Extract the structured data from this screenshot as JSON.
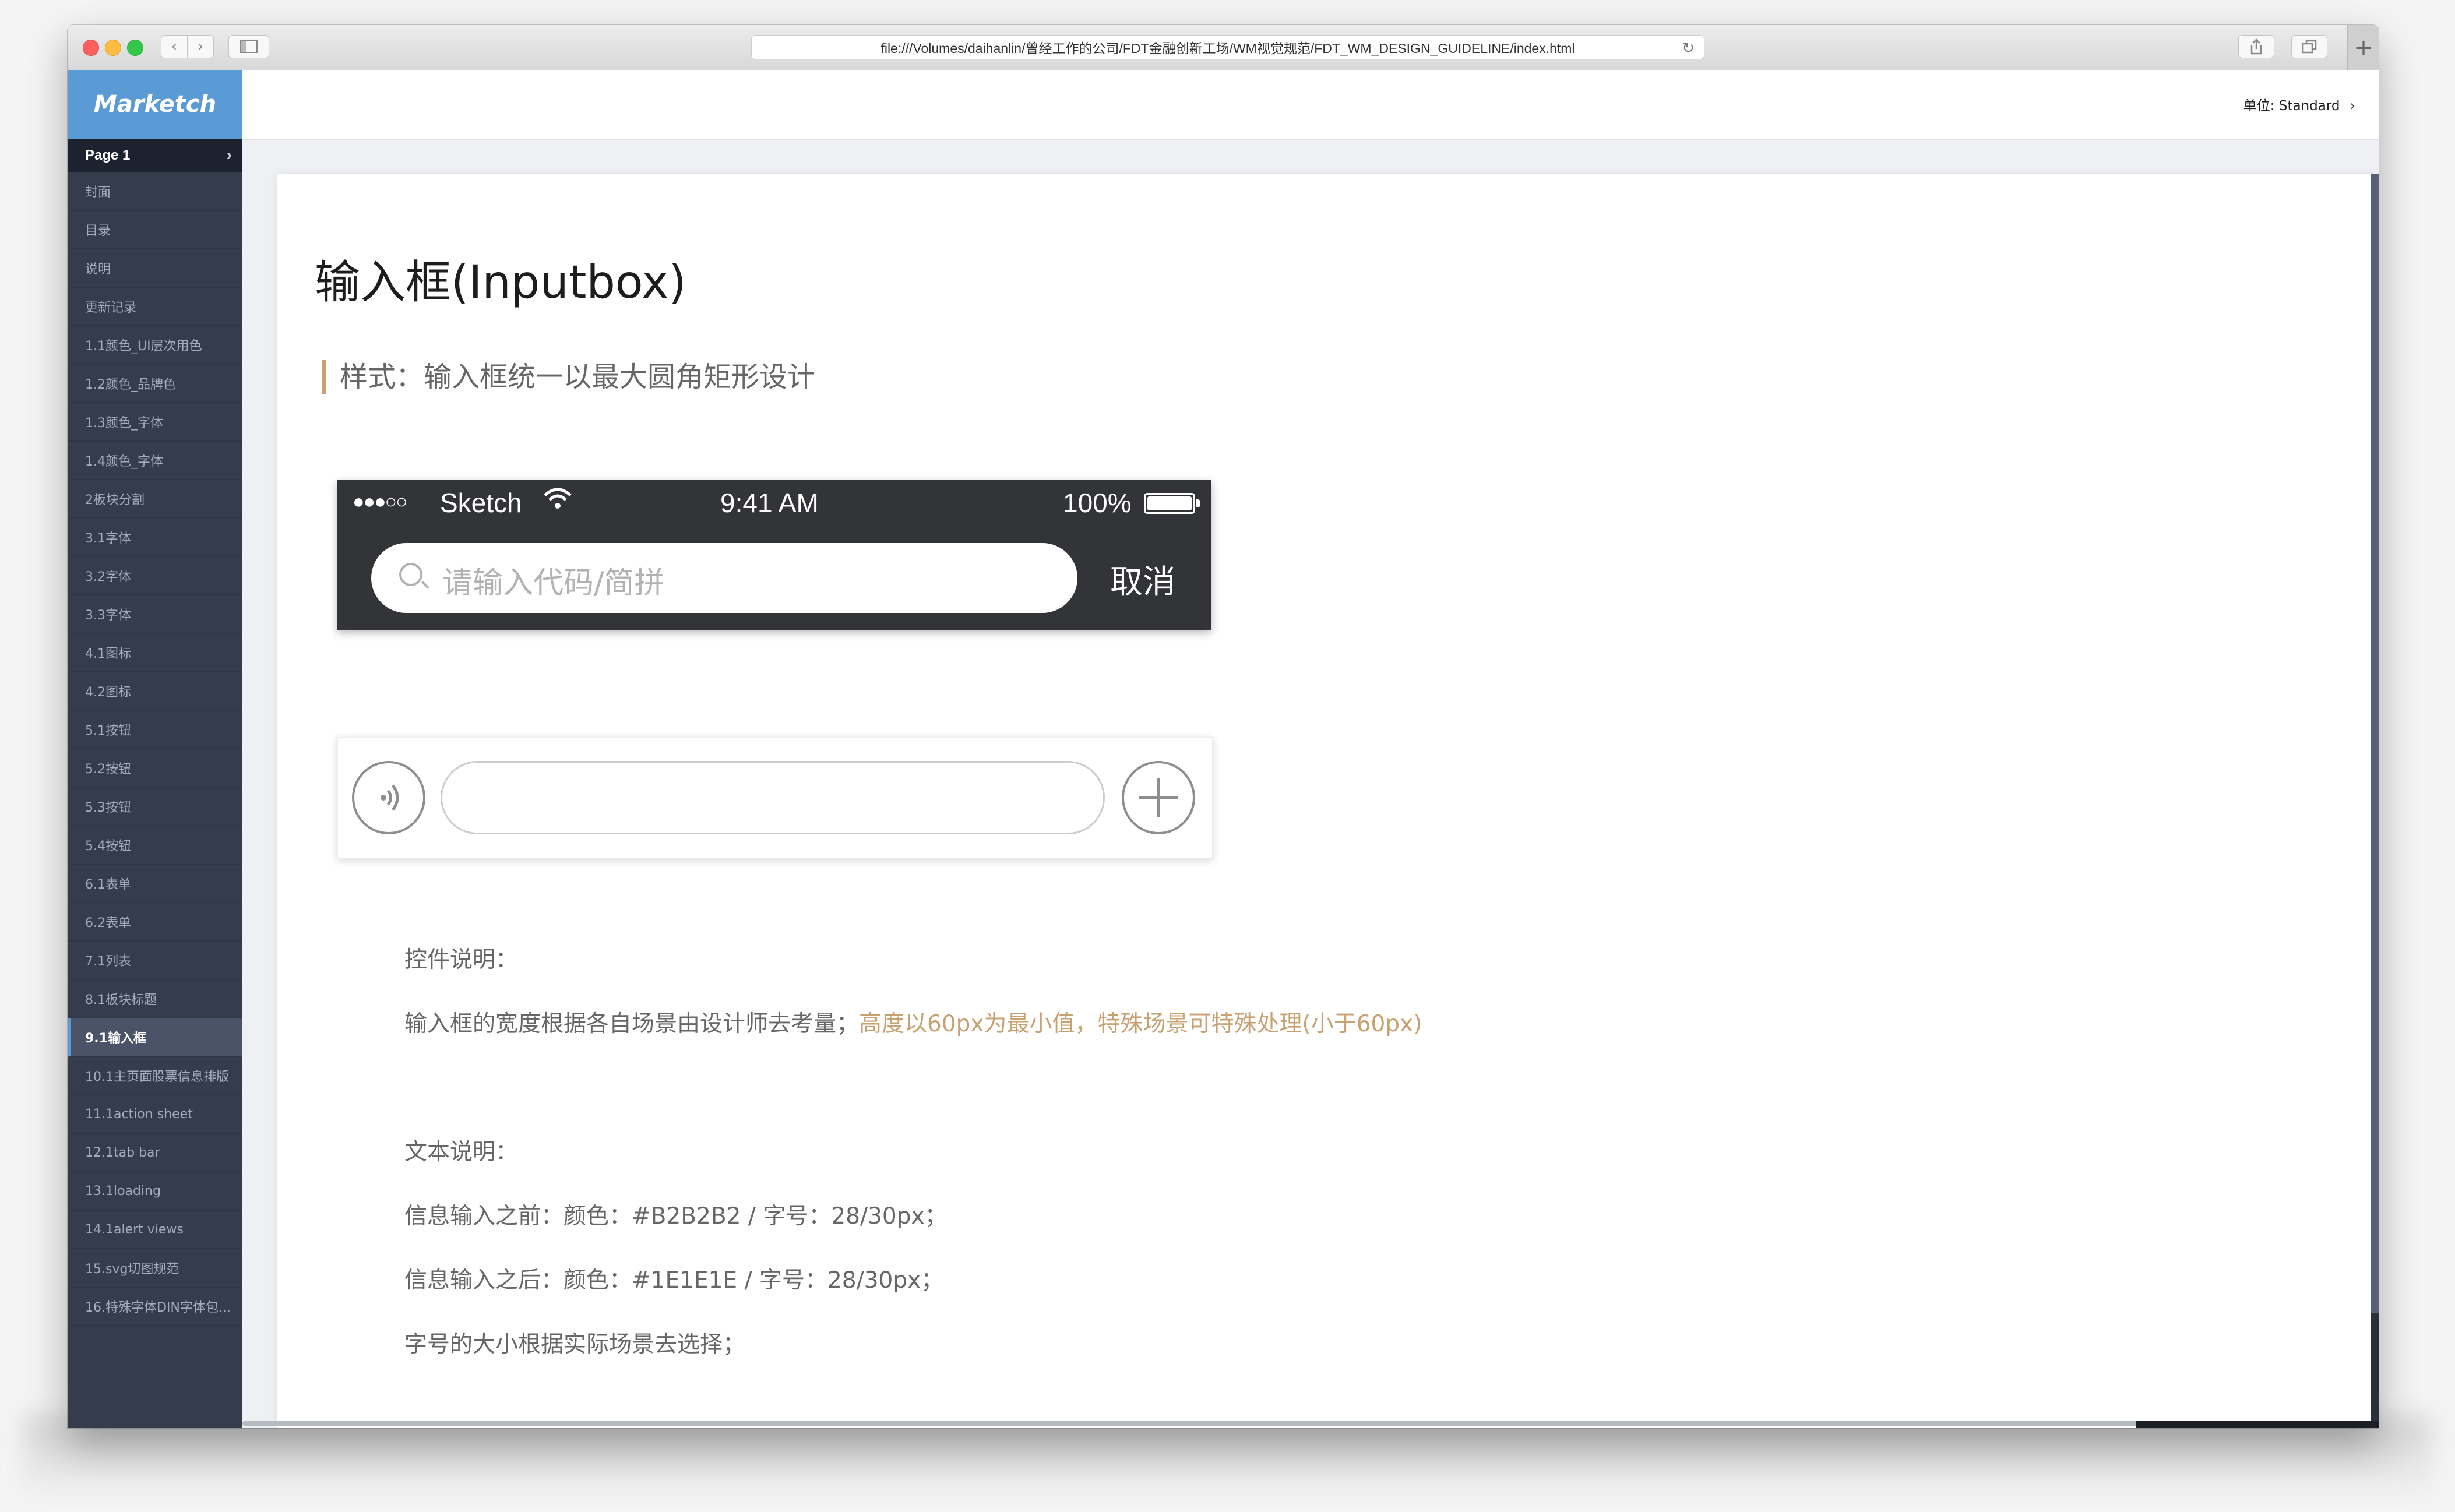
{
  "browser": {
    "url": "file:///Volumes/daihanlin/曾经工作的公司/FDT金融创新工场/WM视觉规范/FDT_WM_DESIGN_GUIDELINE/index.html"
  },
  "sidebar": {
    "brand": "Marketch",
    "page": "Page 1",
    "items": [
      {
        "label": "封面"
      },
      {
        "label": "目录"
      },
      {
        "label": "说明"
      },
      {
        "label": "更新记录"
      },
      {
        "label": "1.1颜色_UI层次用色"
      },
      {
        "label": "1.2颜色_品牌色"
      },
      {
        "label": "1.3颜色_字体"
      },
      {
        "label": "1.4颜色_字体"
      },
      {
        "label": "2板块分割"
      },
      {
        "label": "3.1字体"
      },
      {
        "label": "3.2字体"
      },
      {
        "label": "3.3字体"
      },
      {
        "label": "4.1图标"
      },
      {
        "label": "4.2图标"
      },
      {
        "label": "5.1按钮"
      },
      {
        "label": "5.2按钮"
      },
      {
        "label": "5.3按钮"
      },
      {
        "label": "5.4按钮"
      },
      {
        "label": "6.1表单"
      },
      {
        "label": "6.2表单"
      },
      {
        "label": "7.1列表"
      },
      {
        "label": "8.1板块标题"
      },
      {
        "label": "9.1输入框",
        "active": true
      },
      {
        "label": "10.1主页面股票信息排版"
      },
      {
        "label": "11.1action sheet"
      },
      {
        "label": "12.1tab bar"
      },
      {
        "label": "13.1loading"
      },
      {
        "label": "14.1alert views"
      },
      {
        "label": "15.svg切图规范"
      },
      {
        "label": "16.特殊字体DIN字体包..."
      }
    ]
  },
  "topbar": {
    "unit_label": "单位:",
    "unit_value": "Standard"
  },
  "doc": {
    "title": "输入框(Inputbox)",
    "style_line": "样式：输入框统一以最大圆角矩形设计",
    "phone": {
      "signal": "●●●○○",
      "carrier": "Sketch",
      "time": "9:41 AM",
      "battery": "100%",
      "search_placeholder": "请输入代码/简拼",
      "cancel": "取消"
    },
    "control_heading": "控件说明：",
    "control_desc": "输入框的宽度根据各自场景由设计师去考量；",
    "control_highlight": "高度以60px为最小值，特殊场景可特殊处理(小于60px)",
    "text_heading": "文本说明：",
    "before_input": "信息输入之前：颜色：#B2B2B2  /   字号：28/30px；",
    "after_input": "信息输入之后：颜色：#1E1E1E    /   字号：28/30px；",
    "size_note": "字号的大小根据实际场景去选择；"
  },
  "colors": {
    "accent": "#c7a16f",
    "sidebar_bg": "#353d4d",
    "brand_bg": "#5b9bd5",
    "placeholder_gray": "#B2B2B2",
    "input_text": "#1E1E1E"
  }
}
